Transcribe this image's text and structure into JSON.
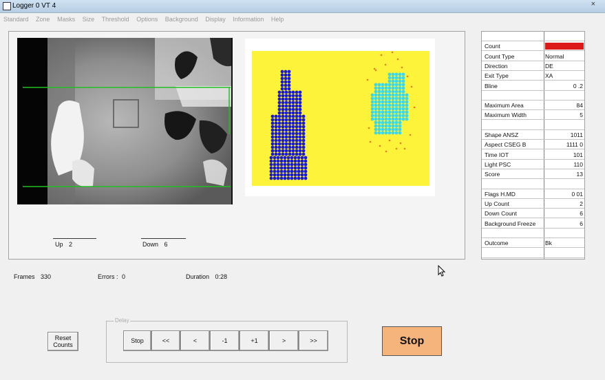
{
  "window": {
    "title": "Logger 0 VT 4",
    "close_glyph": "×"
  },
  "menu": [
    "Standard",
    "Zone",
    "Masks",
    "Size",
    "Threshold",
    "Options",
    "Background",
    "Display",
    "Information",
    "Help"
  ],
  "counters": {
    "up_label": "Up",
    "up_value": "2",
    "down_label": "Down",
    "down_value": "6"
  },
  "status": {
    "frames_label": "Frames",
    "frames_value": "330",
    "errors_label": "Errors :",
    "errors_value": "0",
    "duration_label": "Duration",
    "duration_value": "0:28"
  },
  "side_table": {
    "rows": [
      {
        "label": "",
        "value": ""
      },
      {
        "label": "Count",
        "value": "",
        "highlight": "#dd1a1a"
      },
      {
        "label": "Count Type",
        "value": "Normal",
        "align": "left"
      },
      {
        "label": "Direction",
        "value": "DE",
        "align": "left"
      },
      {
        "label": "Exit Type",
        "value": "XA",
        "align": "left"
      },
      {
        "label": "Bline",
        "value": "0 .2"
      },
      {
        "label": "",
        "value": ""
      },
      {
        "label": "Maximum Area",
        "value": "84"
      },
      {
        "label": "Maximum Width",
        "value": "5"
      },
      {
        "label": "",
        "value": ""
      },
      {
        "label": "Shape ANSZ",
        "value": "1011"
      },
      {
        "label": "Aspect CSEG B",
        "value": "1111 0"
      },
      {
        "label": "Time IOT",
        "value": "101"
      },
      {
        "label": "Light PSC",
        "value": "110"
      },
      {
        "label": "Score",
        "value": "13"
      },
      {
        "label": "",
        "value": ""
      },
      {
        "label": "Flags H.MD",
        "value": "0 01"
      },
      {
        "label": "Up Count",
        "value": "2"
      },
      {
        "label": "Down Count",
        "value": "6"
      },
      {
        "label": "Background Freeze",
        "value": "6"
      },
      {
        "label": "",
        "value": ""
      },
      {
        "label": "Outcome",
        "value": "Bk",
        "align": "left"
      },
      {
        "label": "",
        "value": ""
      }
    ]
  },
  "buttons": {
    "reset_counts_line1": "Reset",
    "reset_counts_line2": "Counts",
    "playback_group_caption": "Delay",
    "playback": [
      "Stop",
      "<<",
      "<",
      "-1",
      "+1",
      ">",
      ">>"
    ],
    "stop_big": "Stop"
  },
  "colors": {
    "grid_background": "#fdf33a",
    "blob_blue": "#1a1acf",
    "blob_cyan": "#3ad8e8",
    "blob_dots": "#e87a2a",
    "zone_lines": "#22c022",
    "stop_button": "#f4b47c"
  },
  "icons": {
    "cursor": "mouse-pointer-icon",
    "app": "app-icon"
  }
}
